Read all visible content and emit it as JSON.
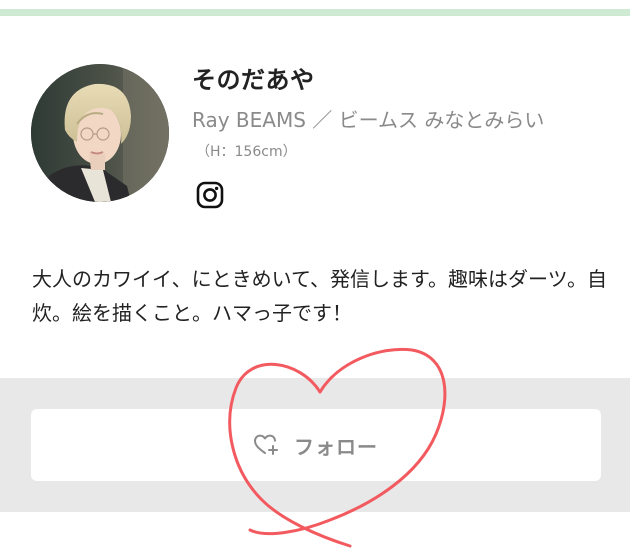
{
  "profile": {
    "name": "そのだあや",
    "shop": "Ray BEAMS ／ ビームス みなとみらい",
    "height": "（H：156cm）",
    "social_icon": "instagram-icon",
    "bio": "大人のカワイイ、にときめいて、発信します。趣味はダーツ。自炊。絵を描くこと。ハマっ子です！"
  },
  "follow": {
    "label": "フォロー",
    "icon": "heart-plus-icon"
  },
  "colors": {
    "accent_bar": "#cfead2",
    "band": "#e8e8e8",
    "heart_doodle": "#f25a5f",
    "muted_text": "#8a8a8a"
  }
}
